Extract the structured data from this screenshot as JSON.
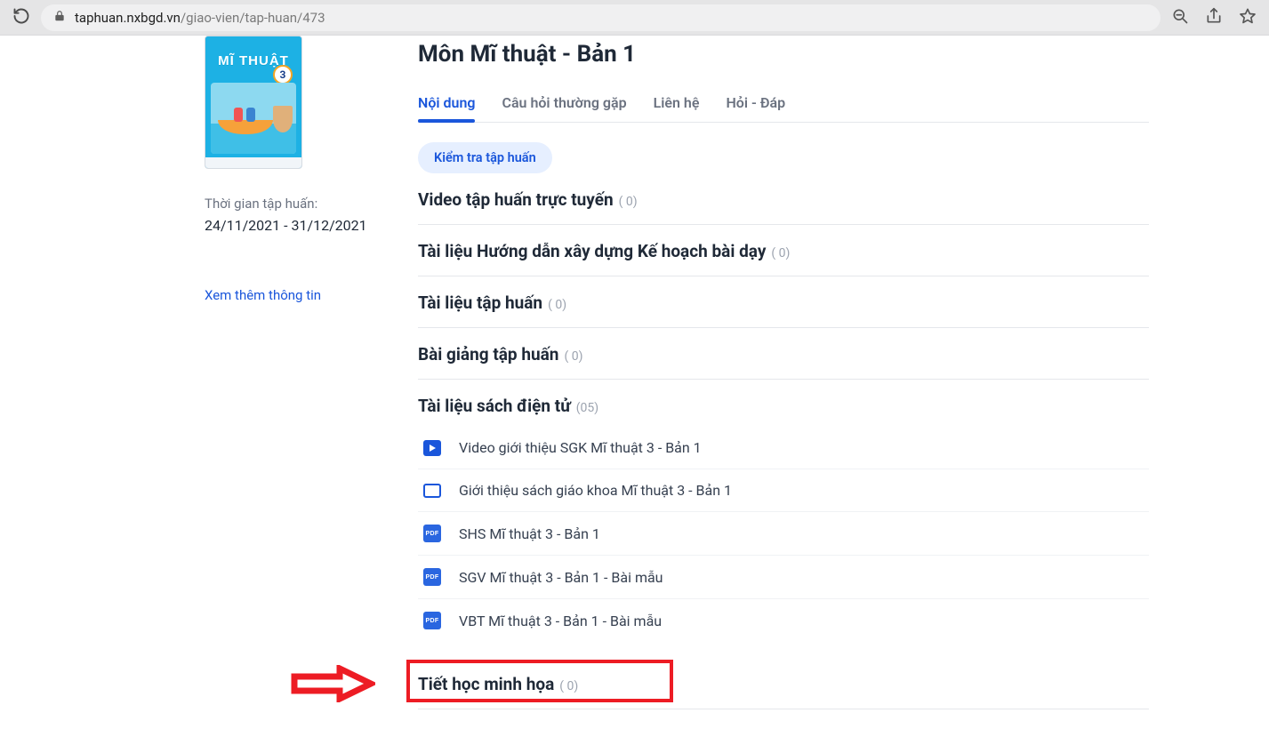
{
  "browser": {
    "url_host": "taphuan.nxbgd.vn",
    "url_path": "/giao-vien/tap-huan/473"
  },
  "sidebar": {
    "thumb_badge": "3",
    "thumb_title": "MĨ THUẬT",
    "time_label": "Thời gian tập huấn:",
    "time_value": "24/11/2021 - 31/12/2021",
    "more_link": "Xem thêm thông tin"
  },
  "main": {
    "title": "Môn Mĩ thuật - Bản 1",
    "tabs": [
      {
        "label": "Nội dung",
        "active": true
      },
      {
        "label": "Câu hỏi thường gặp",
        "active": false
      },
      {
        "label": "Liên hệ",
        "active": false
      },
      {
        "label": "Hỏi - Đáp",
        "active": false
      }
    ],
    "chip": "Kiểm tra tập huấn",
    "sections": [
      {
        "title": "Video tập huấn trực tuyến",
        "count": "( 0)"
      },
      {
        "title": "Tài liệu Hướng dẫn xây dựng Kế hoạch bài dạy",
        "count": "( 0)"
      },
      {
        "title": "Tài liệu tập huấn",
        "count": "( 0)"
      },
      {
        "title": "Bài giảng tập huấn",
        "count": "( 0)"
      },
      {
        "title": "Tài liệu sách điện tử",
        "count": "(05)",
        "items": [
          {
            "icon": "play",
            "label": "Video giới thiệu SGK Mĩ thuật 3 - Bản 1"
          },
          {
            "icon": "slide",
            "label": "Giới thiệu sách giáo khoa Mĩ thuật 3 - Bản 1"
          },
          {
            "icon": "pdf",
            "label": "SHS Mĩ thuật 3 - Bản 1"
          },
          {
            "icon": "pdf",
            "label": "SGV Mĩ thuật 3 - Bản 1 - Bài mẫu"
          },
          {
            "icon": "pdf",
            "label": "VBT Mĩ thuật 3 - Bản 1 - Bài mẫu",
            "highlight": true
          }
        ]
      },
      {
        "title": "Tiết học minh họa",
        "count": "( 0)"
      }
    ],
    "pdf_label": "PDF"
  }
}
